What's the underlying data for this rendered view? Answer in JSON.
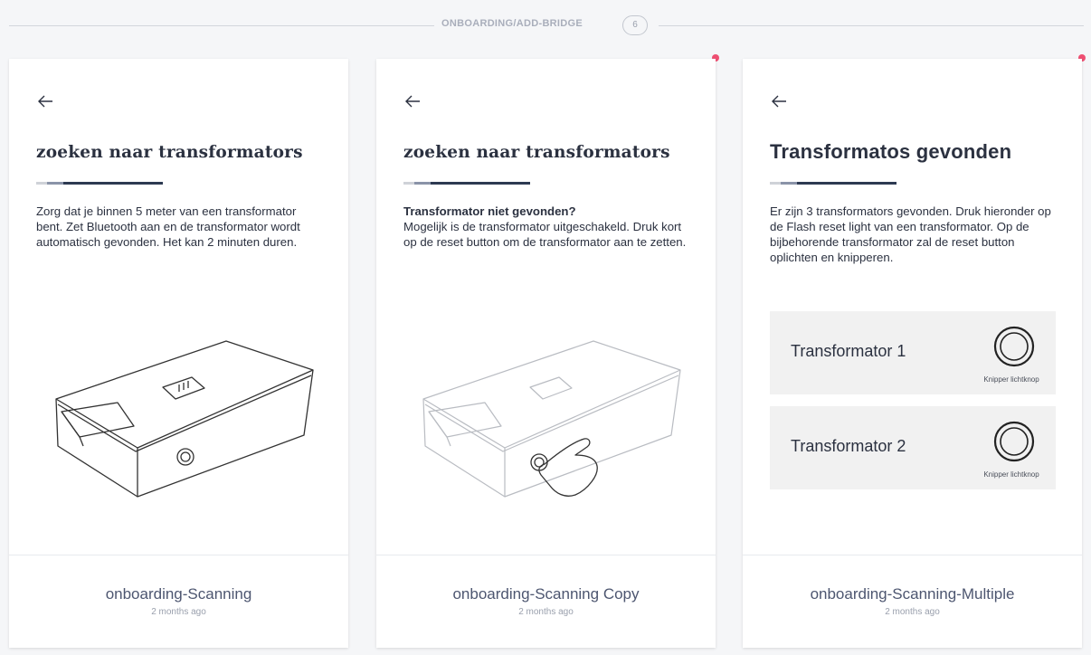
{
  "section": {
    "title": "ONBOARDING/ADD-BRIDGE",
    "count": "6"
  },
  "colors": {
    "accent_dot": "#ee4f72",
    "progress_active": "#2d3a52",
    "title_text": "#2b3140"
  },
  "cards": [
    {
      "title": "zoeken naar transformators",
      "body": "Zorg dat je binnen 5 meter van een transformator bent. Zet Bluetooth aan en de transformator wordt automatisch gevonden. Het kan 2 minuten duren.",
      "name": "onboarding-Scanning",
      "time": "2 months ago"
    },
    {
      "title": "zoeken naar transformators",
      "body_heading": "Transformator niet gevonden?",
      "body": "Mogelijk is de transformator uitgeschakeld. Druk kort op de reset button om de transformator aan te zetten.",
      "name": "onboarding-Scanning Copy",
      "time": "2 months ago"
    },
    {
      "title": "Transformatos gevonden",
      "body": "Er zijn 3 transformators gevonden. Druk hieronder op de Flash reset light van een transformator. Op de bijbehorende transformator zal de reset button oplichten en knipperen.",
      "results": [
        {
          "label": "Transformator 1",
          "caption": "Knipper lichtknop"
        },
        {
          "label": "Transformator 2",
          "caption": "Knipper lichtknop"
        }
      ],
      "name": "onboarding-Scanning-Multiple",
      "time": "2 months ago"
    }
  ]
}
